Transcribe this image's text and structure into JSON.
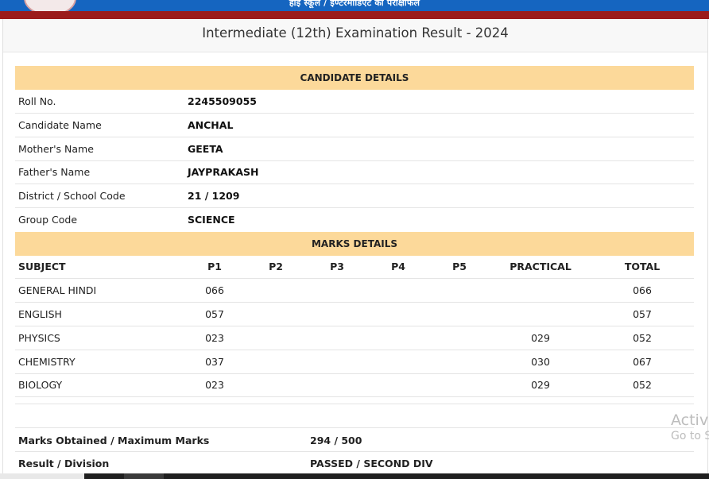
{
  "header": {
    "banner_text": "हाई स्कूल / इण्टरमीडिएट का परीक्षाफल",
    "title": "Intermediate (12th) Examination Result - 2024"
  },
  "candidate": {
    "heading": "CANDIDATE DETAILS",
    "rows": [
      {
        "label": "Roll No.",
        "value": "2245509055"
      },
      {
        "label": "Candidate Name",
        "value": "ANCHAL"
      },
      {
        "label": "Mother's Name",
        "value": "GEETA"
      },
      {
        "label": "Father's Name",
        "value": "JAYPRAKASH"
      },
      {
        "label": "District / School Code",
        "value": "21 / 1209"
      },
      {
        "label": "Group Code",
        "value": "SCIENCE"
      }
    ]
  },
  "marks": {
    "heading": "MARKS DETAILS",
    "columns": [
      "SUBJECT",
      "P1",
      "P2",
      "P3",
      "P4",
      "P5",
      "PRACTICAL",
      "TOTAL"
    ],
    "rows": [
      {
        "subject": "GENERAL HINDI",
        "p1": "066",
        "p2": "",
        "p3": "",
        "p4": "",
        "p5": "",
        "practical": "",
        "total": "066"
      },
      {
        "subject": "ENGLISH",
        "p1": "057",
        "p2": "",
        "p3": "",
        "p4": "",
        "p5": "",
        "practical": "",
        "total": "057"
      },
      {
        "subject": "PHYSICS",
        "p1": "023",
        "p2": "",
        "p3": "",
        "p4": "",
        "p5": "",
        "practical": "029",
        "total": "052"
      },
      {
        "subject": "CHEMISTRY",
        "p1": "037",
        "p2": "",
        "p3": "",
        "p4": "",
        "p5": "",
        "practical": "030",
        "total": "067"
      },
      {
        "subject": "BIOLOGY",
        "p1": "023",
        "p2": "",
        "p3": "",
        "p4": "",
        "p5": "",
        "practical": "029",
        "total": "052"
      }
    ]
  },
  "summary": {
    "marks_label": "Marks Obtained / Maximum Marks",
    "marks_value": "294 / 500",
    "result_label": "Result / Division",
    "result_value": "PASSED / SECOND DIV"
  },
  "watermark": {
    "line1": "Activ",
    "line2": "Go to S"
  }
}
